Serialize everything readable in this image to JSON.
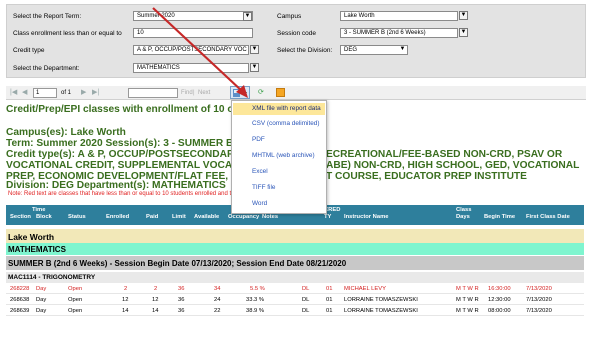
{
  "params": {
    "report_term_label": "Select the Report Term:",
    "report_term_value": "Summer 2020",
    "enrollment_label": "Class enrollment less than or equal to",
    "enrollment_value": "10",
    "credit_type_label": "Credit type",
    "credit_type_value": "A & P, OCCUP/POSTSECONDARY VOC",
    "department_label": "Select the Department:",
    "department_value": "MATHEMATICS",
    "campus_label": "Campus",
    "campus_value": "Lake Worth",
    "session_label": "Session code",
    "session_value": "3 - SUMMER B (2nd 6 Weeks)",
    "division_label": "Select the Division:",
    "division_value": "DEG"
  },
  "toolbar": {
    "page_value": "1",
    "page_of": "of 1",
    "find_label": "Find",
    "next_label": "Next"
  },
  "export_menu": {
    "items": [
      "XML file with report data",
      "CSV (comma delimited)",
      "PDF",
      "MHTML (web archive)",
      "Excel",
      "TIFF file",
      "Word"
    ]
  },
  "report": {
    "title": "Credit/Prep/EPI classes with enrollment of 10 or les",
    "campus_line": "Campus(es): Lake Worth",
    "term_line": "Term: Summer 2020    Session(s): 3 - SUMMER B (2",
    "credit_line_1": "Credit type(s): A & P, OCCUP/POSTSECONDARY V",
    "credit_line_1b": "ECREATIONAL/FEE-BASED NON-CRD, PSAV OR",
    "credit_line_2": "VOCATIONAL CREDIT, SUPPLEMENTAL VOCATION",
    "credit_line_2b": "ABE) NON-CRD, HIGH SCHOOL, GED, VOCATIONAL",
    "credit_line_3": "PREP, ECONOMIC DEVELOPMENT/FLAT FEE, LIFEL",
    "credit_line_3b": "T COURSE, EDUCATOR PREP INSTITUTE",
    "division_line": "Division: DEG      Department(s): MATHEMATICS",
    "note": "Note: Red text are classes that have less than or equal to 10 students enrolled and the Class Status is Open or Held."
  },
  "table": {
    "headers": {
      "section": "Section",
      "block_top": "Time",
      "block": "Block",
      "status": "Status",
      "enrolled": "Enrolled",
      "paid": "Paid",
      "limit": "Limit",
      "available": "Available",
      "occupancy": "Occupancy",
      "notes": "Notes",
      "cred_top": "CRED",
      "ty": "TY",
      "instructor": "Instructor Name",
      "class_top": "Class",
      "days": "Days",
      "begin": "Begin Time",
      "first_class": "First Class Date"
    },
    "campus": "Lake Worth",
    "department": "MATHEMATICS",
    "session": "SUMMER B (2nd 6 Weeks) - Session Begin Date 07/13/2020; Session End Date 08/21/2020",
    "course": "MAC1114 - TRIGONOMETRY",
    "rows": [
      {
        "section": "268228",
        "block": "Day",
        "status": "Open",
        "enrolled": "2",
        "paid": "2",
        "limit": "36",
        "available": "34",
        "occupancy": "5.5 %",
        "dl": "DL",
        "ty": "01",
        "instructor": "MICHAEL LEVY",
        "days": "M T W R",
        "begin": "16:30:00",
        "first": "7/13/2020"
      },
      {
        "section": "268638",
        "block": "Day",
        "status": "Open",
        "enrolled": "12",
        "paid": "12",
        "limit": "36",
        "available": "24",
        "occupancy": "33.3 %",
        "dl": "DL",
        "ty": "01",
        "instructor": "LORRAINE TOMASZEWSKI",
        "days": "M T W R",
        "begin": "12:30:00",
        "first": "7/13/2020"
      },
      {
        "section": "268639",
        "block": "Day",
        "status": "Open",
        "enrolled": "14",
        "paid": "14",
        "limit": "36",
        "available": "22",
        "occupancy": "38.9 %",
        "dl": "DL",
        "ty": "01",
        "instructor": "LORRAINE TOMASZEWSKI",
        "days": "M T W R",
        "begin": "08:00:00",
        "first": "7/13/2020"
      }
    ]
  },
  "colors": {
    "heading_green": "#3a6e1f",
    "header_teal": "#2e7f9c",
    "campus_band": "#f2e8b8",
    "dept_band": "#7ff5cf",
    "session_band": "#c8c8c8",
    "course_band": "#e9e9e9",
    "alert_red": "#d42020",
    "menu_highlight": "#fde79a"
  }
}
